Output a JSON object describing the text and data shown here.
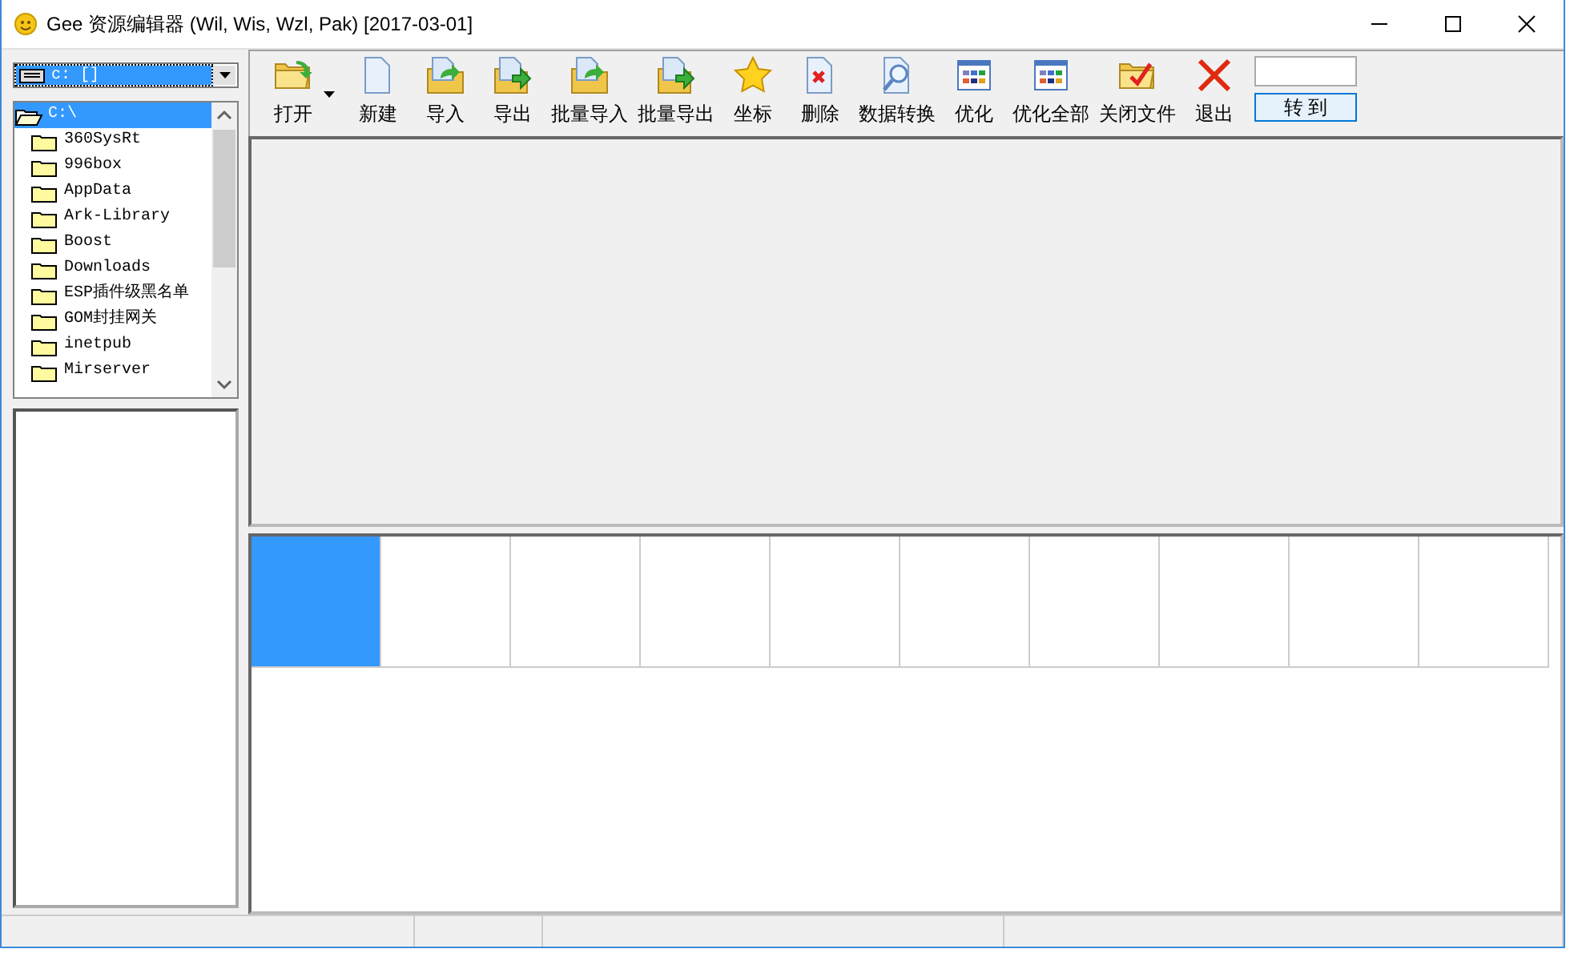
{
  "window": {
    "title": "Gee 资源编辑器 (Wil, Wis, Wzl, Pak) [2017-03-01]"
  },
  "drive_combo": {
    "value": "c: []"
  },
  "folder_tree": [
    {
      "label": "C:\\",
      "selected": true,
      "expanded": true,
      "children": [
        {
          "label": "360SysRt",
          "selected": false
        },
        {
          "label": "996box",
          "selected": false
        },
        {
          "label": "AppData",
          "selected": false
        },
        {
          "label": "Ark-Library",
          "selected": false
        },
        {
          "label": "Boost",
          "selected": false
        },
        {
          "label": "Downloads",
          "selected": false
        },
        {
          "label": "ESP插件级黑名单",
          "selected": false
        },
        {
          "label": "GOM封挂网关",
          "selected": false
        },
        {
          "label": "inetpub",
          "selected": false
        },
        {
          "label": "Mirserver",
          "selected": false
        }
      ]
    }
  ],
  "toolbar": [
    {
      "label": "打开",
      "kind": "open",
      "dropdown": true
    },
    {
      "label": "新建",
      "kind": "new",
      "dropdown": false
    },
    {
      "label": "导入",
      "kind": "import",
      "dropdown": false
    },
    {
      "label": "导出",
      "kind": "export",
      "dropdown": false
    },
    {
      "label": "批量导入",
      "kind": "import",
      "dropdown": false
    },
    {
      "label": "批量导出",
      "kind": "export",
      "dropdown": false
    },
    {
      "label": "坐标",
      "kind": "star",
      "dropdown": false
    },
    {
      "label": "删除",
      "kind": "delete",
      "dropdown": false
    },
    {
      "label": "数据转换",
      "kind": "convert",
      "dropdown": false
    },
    {
      "label": "优化",
      "kind": "optimize",
      "dropdown": false
    },
    {
      "label": "优化全部",
      "kind": "optimize",
      "dropdown": false
    },
    {
      "label": "关闭文件",
      "kind": "close-file",
      "dropdown": false
    },
    {
      "label": "退出",
      "kind": "exit",
      "dropdown": false
    }
  ],
  "goto": {
    "button": "转 到"
  },
  "thumbnails": [
    {
      "selected": true
    },
    {
      "selected": false
    },
    {
      "selected": false
    },
    {
      "selected": false
    },
    {
      "selected": false
    },
    {
      "selected": false
    },
    {
      "selected": false
    },
    {
      "selected": false
    },
    {
      "selected": false
    },
    {
      "selected": false
    }
  ]
}
